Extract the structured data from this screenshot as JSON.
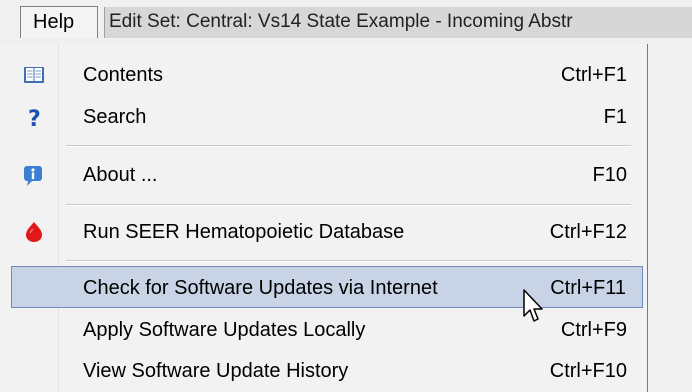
{
  "menubar": {
    "help_label": "Help",
    "window_title": "Edit Set: Central: Vs14 State Example - Incoming Abstr"
  },
  "menu": {
    "items": [
      {
        "label": "Contents",
        "shortcut": "Ctrl+F1",
        "icon": "book-icon"
      },
      {
        "label": "Search",
        "shortcut": "F1",
        "icon": "question-mark-icon"
      },
      {
        "label": "About ...",
        "shortcut": "F10",
        "icon": "info-icon"
      },
      {
        "label": "Run SEER Hematopoietic Database",
        "shortcut": "Ctrl+F12",
        "icon": "red-blood-drop-icon"
      },
      {
        "label": "Check for Software Updates via Internet",
        "shortcut": "Ctrl+F11",
        "icon": "",
        "selected": true
      },
      {
        "label": "Apply Software Updates Locally",
        "shortcut": "Ctrl+F9",
        "icon": ""
      },
      {
        "label": "View Software Update History",
        "shortcut": "Ctrl+F10",
        "icon": ""
      }
    ]
  },
  "colors": {
    "selection_fill": "#c8d3e6",
    "selection_border": "#6f8bbd",
    "menu_background": "#f2f2f2"
  }
}
